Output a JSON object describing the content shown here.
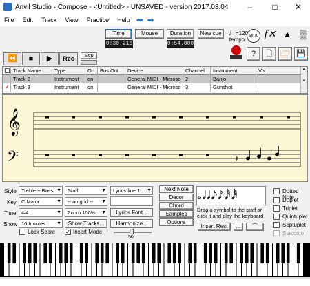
{
  "window": {
    "title": "Anvil Studio - Compose - <Untitled> - UNSAVED - version 2017.03.04"
  },
  "menu": [
    "File",
    "Edit",
    "Track",
    "View",
    "Practice",
    "Help"
  ],
  "toolbar": {
    "time_label": "Time",
    "mouse_label": "Mouse",
    "duration_label": "Duration",
    "newcue_label": "New cue",
    "time_value": "0:30.216",
    "duration_value": "0:54.000",
    "rec_label": "Rec",
    "step_label": "step",
    "tempo_value": "=120",
    "tempo_label": "tempo"
  },
  "tracks": {
    "columns": [
      "Track Name",
      "Type",
      "On",
      "Bus Out",
      "Device",
      "Channel",
      "Instrument",
      "Vol"
    ],
    "rows": [
      [
        "Track 2",
        "Instrument",
        "on",
        "",
        "General MIDI - Microso",
        "2",
        "Banjo",
        ""
      ],
      [
        "Track 3",
        "Instrument",
        "on",
        "",
        "General MIDI - Microso",
        "3",
        "Gunshot",
        ""
      ]
    ]
  },
  "panel": {
    "style_label": "Style",
    "style_value": "Treble + Bass",
    "key_label": "Key",
    "key_value": "C Major",
    "time_label": "Time",
    "time_value": "4/4",
    "show_label": "Show",
    "show_value": "16th notes",
    "staff_value": "Staff",
    "grid_value": "-- no grid --",
    "zoom_value": "Zoom 100%",
    "show_tracks_label": "Show Tracks...",
    "lyrics_line_value": "Lyrics line 1",
    "lyrics_font_label": "Lyrics Font...",
    "harmonize_label": "Harmonize...",
    "lock_score_label": "Lock Score",
    "insert_mode_label": "Insert Mode",
    "next_note_label": "Next Note",
    "decor_label": "Decor",
    "chord_label": "Chord",
    "samples_label": "Samples",
    "options_label": "Options",
    "drag_hint": "Drag a symbol to the staff or click it and play the keyboard",
    "insert_rest_label": "Insert Rest",
    "ellipsis_label": "...",
    "dotted_label": "Dotted Note",
    "duplet_label": "Duplet",
    "triplet_label": "Triplet",
    "quintuplet_label": "Quintuplet",
    "septuplet_label": "Septuplet",
    "staccato_label": "Staccato",
    "velocity_value": "50"
  },
  "colors": {
    "staff_bg": "#fdf7d6",
    "selected_row": "#c8c8c8",
    "accent_blue": "#2a7bd8",
    "red": "#d00000"
  }
}
